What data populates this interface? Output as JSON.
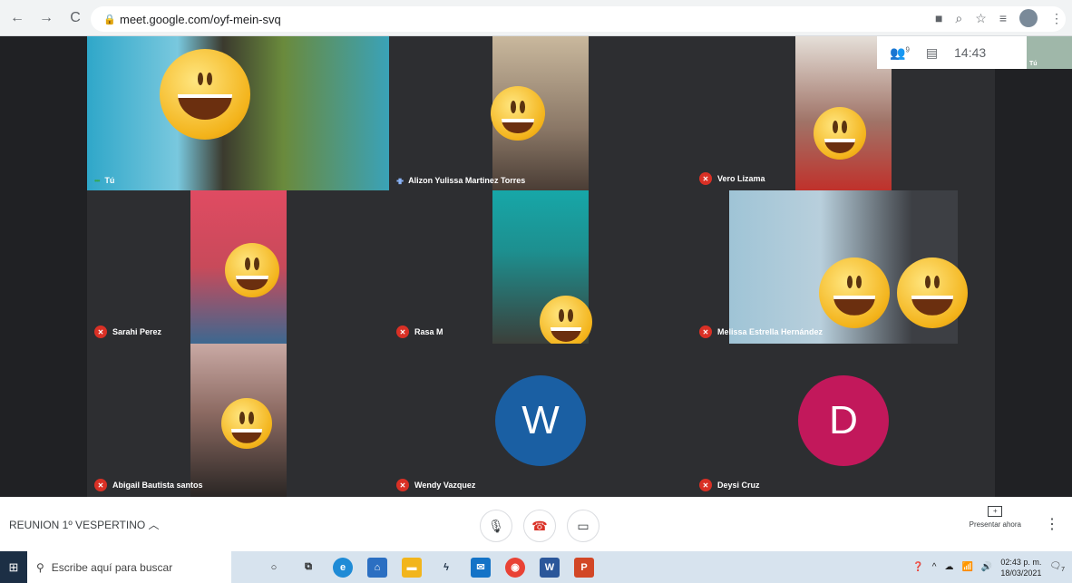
{
  "browser": {
    "url": "meet.google.com/oyf-mein-svq"
  },
  "meet_overlay": {
    "participants_count": "9",
    "time": "14:43",
    "self_label": "Tú"
  },
  "tiles": [
    {
      "name": "Tú",
      "muted": false
    },
    {
      "name": "Alizon Yulissa Martinez Torres",
      "muted": false
    },
    {
      "name": "Vero Lizama",
      "muted": true
    },
    {
      "name": "Sarahi Perez",
      "muted": true
    },
    {
      "name": "Rasa M",
      "muted": true
    },
    {
      "name": "Melissa Estrella Hernández",
      "muted": true
    },
    {
      "name": "Abigail Bautista santos",
      "muted": true
    },
    {
      "name": "Wendy Vazquez",
      "muted": true,
      "avatar_letter": "W",
      "avatar_color": "#1a5fa3"
    },
    {
      "name": "Deysi Cruz",
      "muted": true,
      "avatar_letter": "D",
      "avatar_color": "#c2185b"
    }
  ],
  "controls": {
    "meeting_title": "REUNION 1º VESPERTINO",
    "present_label": "Presentar ahora"
  },
  "taskbar": {
    "search_placeholder": "Escribe aquí para buscar",
    "time": "02:43 p. m.",
    "date": "18/03/2021",
    "notification_count": "7"
  }
}
